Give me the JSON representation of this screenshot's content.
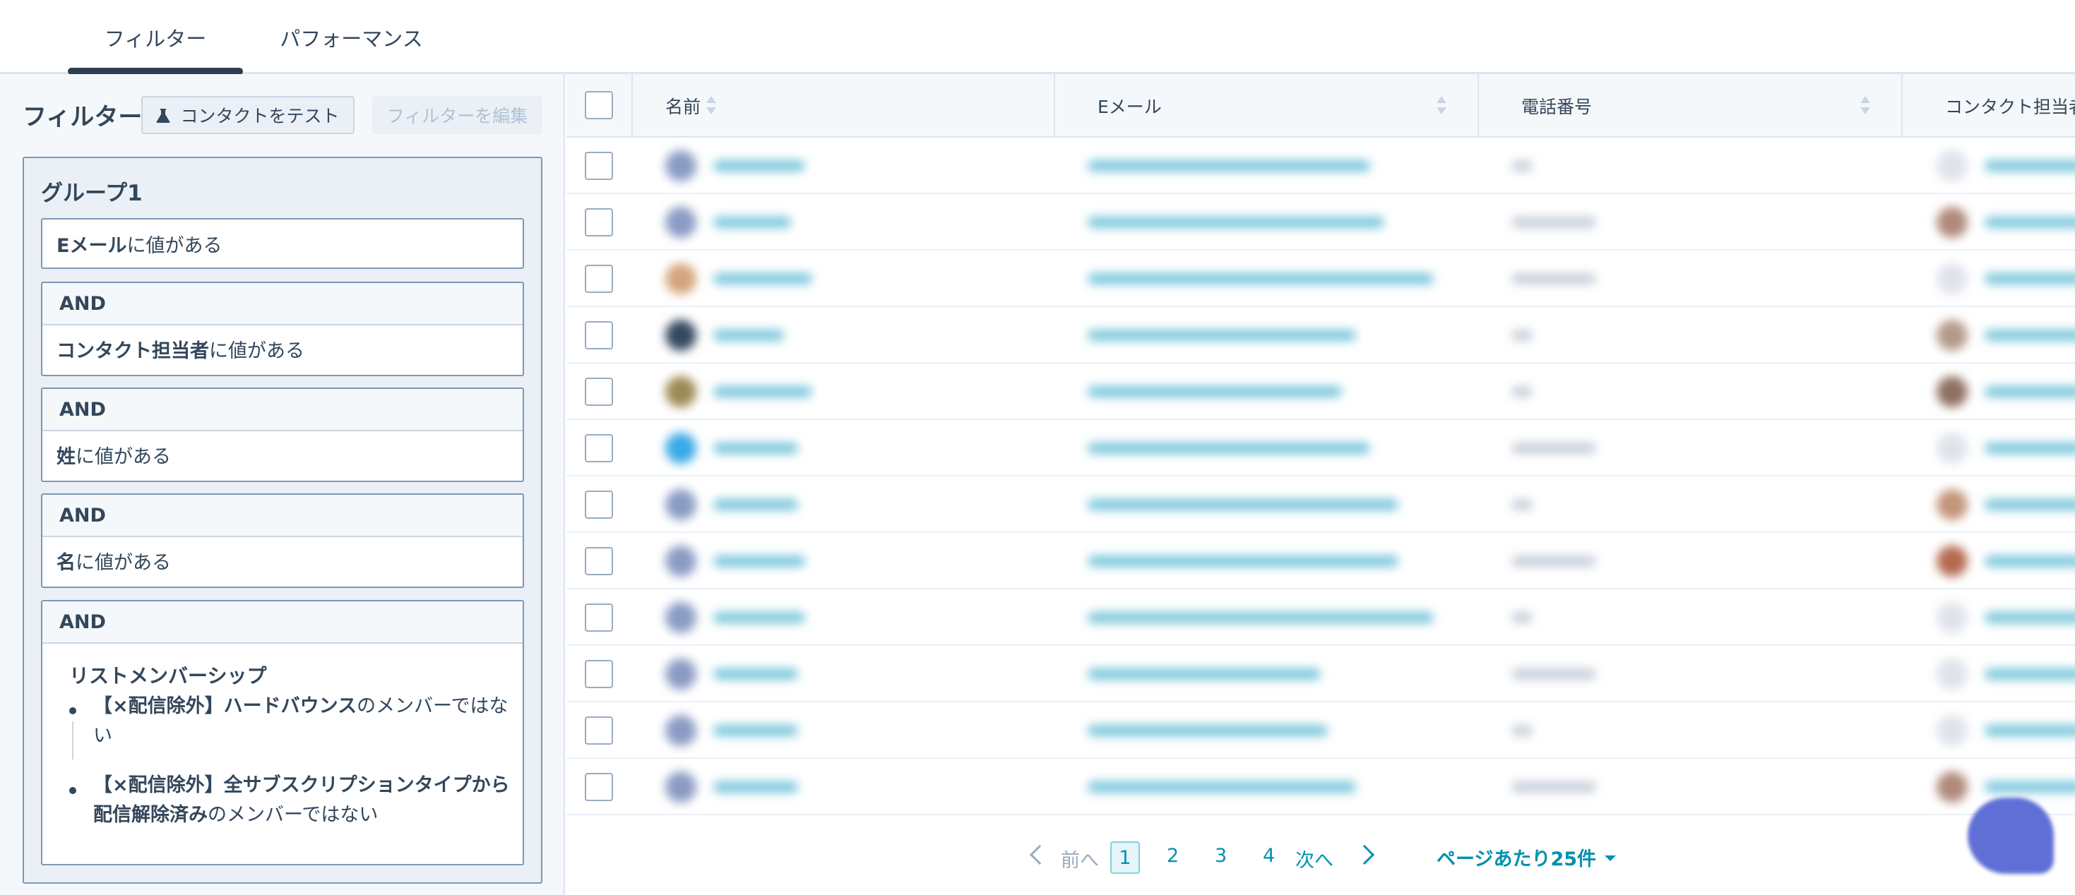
{
  "tabs": [
    {
      "label": "フィルター",
      "active": true
    },
    {
      "label": "パフォーマンス",
      "active": false
    }
  ],
  "filter_panel": {
    "title": "フィルター",
    "test_button": "コンタクトをテスト",
    "edit_button": "フィルターを編集",
    "group_title": "グループ1",
    "and_label": "AND",
    "conditions": [
      {
        "field": "Eメール",
        "op": "に値がある"
      },
      {
        "field": "コンタクト担当者",
        "op": "に値がある"
      },
      {
        "field": "姓",
        "op": "に値がある"
      },
      {
        "field": "名",
        "op": "に値がある"
      }
    ],
    "list_membership": {
      "title": "リストメンバーシップ",
      "items": [
        {
          "bold": "【×配信除外】ハードバウンス",
          "rest": "のメンバーではない"
        },
        {
          "bold": "【×配信除外】全サブスクリプションタイプから配信解除済み",
          "rest": "のメンバーではない"
        }
      ]
    }
  },
  "table": {
    "columns": [
      "名前",
      "Eメール",
      "電話番号",
      "コンタクト担当者"
    ],
    "row_count": 12
  },
  "pagination": {
    "prev": "前へ",
    "next": "次へ",
    "pages": [
      "1",
      "2",
      "3",
      "4"
    ],
    "current": "1",
    "per_page": "ページあたり25件"
  },
  "colors": {
    "link": "#0091ae",
    "border": "#7c98b6",
    "text": "#33475b",
    "fab": "#5f6fd6"
  }
}
